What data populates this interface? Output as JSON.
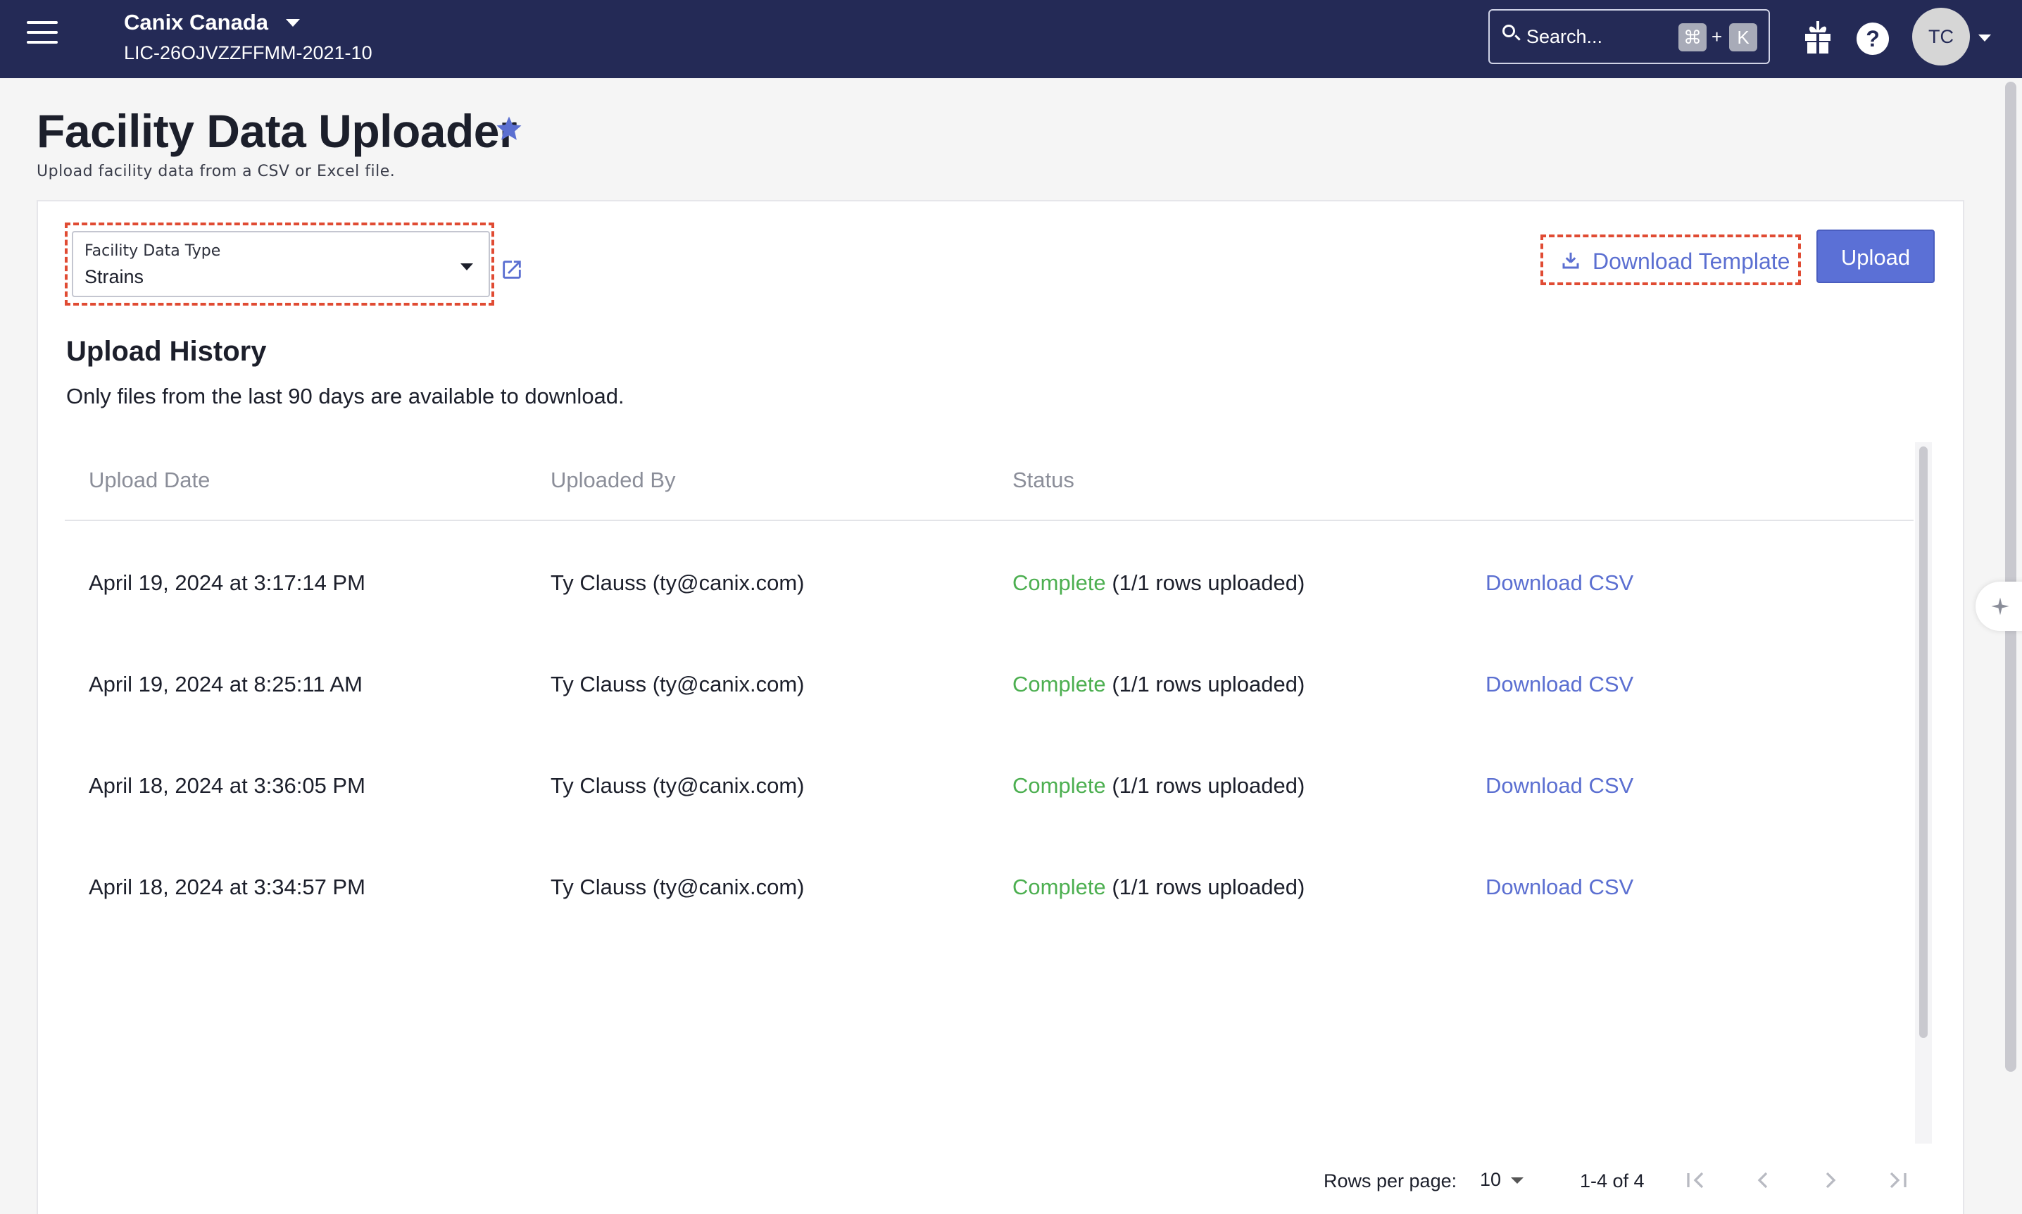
{
  "topbar": {
    "org_name": "Canix Canada",
    "license": "LIC-26OJVZZFFMM-2021-10",
    "search_placeholder": "Search...",
    "shortcut_cmd": "⌘",
    "shortcut_plus": "+",
    "shortcut_key": "K",
    "help_label": "?",
    "avatar_initials": "TC"
  },
  "page": {
    "title": "Facility Data Uploader",
    "subtitle": "Upload facility data from a CSV or Excel file."
  },
  "controls": {
    "type_label": "Facility Data Type",
    "type_value": "Strains",
    "download_template_label": "Download Template",
    "upload_label": "Upload"
  },
  "history": {
    "title": "Upload History",
    "note": "Only files from the last 90 days are available to download.",
    "columns": [
      "Upload Date",
      "Uploaded By",
      "Status"
    ],
    "rows": [
      {
        "date": "April 19, 2024 at 3:17:14 PM",
        "by": "Ty Clauss (ty@canix.com)",
        "status": "Complete",
        "detail": "(1/1 rows uploaded)",
        "action": "Download CSV"
      },
      {
        "date": "April 19, 2024 at 8:25:11 AM",
        "by": "Ty Clauss (ty@canix.com)",
        "status": "Complete",
        "detail": "(1/1 rows uploaded)",
        "action": "Download CSV"
      },
      {
        "date": "April 18, 2024 at 3:36:05 PM",
        "by": "Ty Clauss (ty@canix.com)",
        "status": "Complete",
        "detail": "(1/1 rows uploaded)",
        "action": "Download CSV"
      },
      {
        "date": "April 18, 2024 at 3:34:57 PM",
        "by": "Ty Clauss (ty@canix.com)",
        "status": "Complete",
        "detail": "(1/1 rows uploaded)",
        "action": "Download CSV"
      }
    ]
  },
  "pagination": {
    "rows_per_page_label": "Rows per page:",
    "rows_per_page": "10",
    "range": "1-4 of 4"
  },
  "colors": {
    "topbar": "#242a56",
    "accent": "#5b70d6",
    "status_complete": "#4caf50",
    "highlight_dashed": "#e04b33"
  }
}
